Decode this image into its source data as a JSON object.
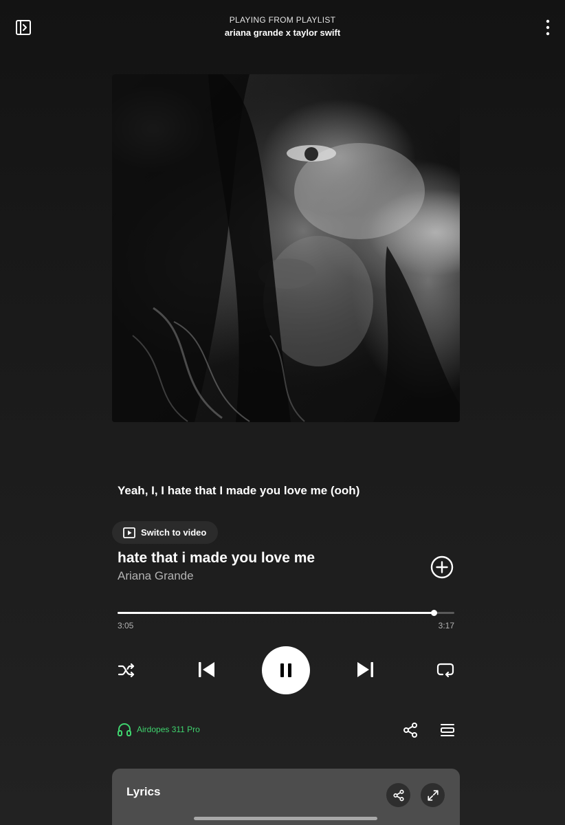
{
  "header": {
    "context_label": "PLAYING FROM PLAYLIST",
    "playlist_name": "ariana grande x taylor swift"
  },
  "now_playing": {
    "current_lyric": "Yeah, I, I hate that I made you love me (ooh)",
    "switch_video_label": "Switch to video",
    "title": "hate that i made you love me",
    "artist": "Ariana Grande",
    "elapsed": "3:05",
    "duration": "3:17",
    "progress_fraction": 0.939
  },
  "controls": {
    "shuffle_icon": "shuffle-icon",
    "previous_icon": "skip-previous-icon",
    "play_state_icon": "pause-icon",
    "next_icon": "skip-next-icon",
    "repeat_icon": "repeat-icon"
  },
  "device": {
    "name": "Airdopes 311 Pro",
    "icon": "headphones-icon",
    "color": "#3fd46e"
  },
  "lyrics_card": {
    "heading": "Lyrics"
  },
  "colors": {
    "background": "#181818",
    "accent": "#3fd46e",
    "card": "#4d4d4d"
  }
}
